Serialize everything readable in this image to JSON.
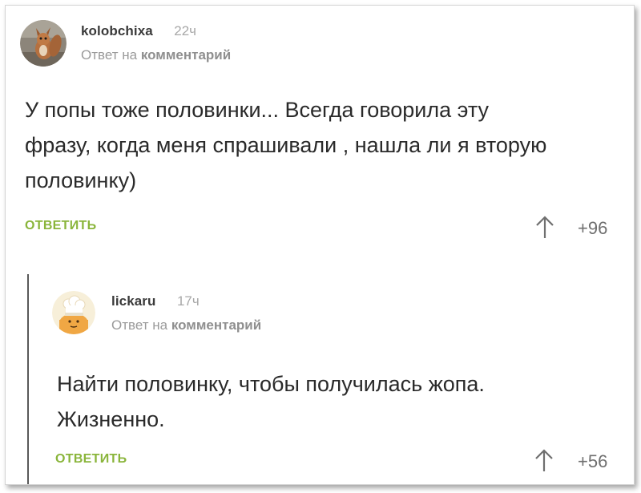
{
  "comments": [
    {
      "username": "kolobchixa",
      "time": "22ч",
      "reply_prefix": "Ответ на",
      "reply_link": "комментарий",
      "lines": [
        "У попы тоже половинки... Всегда говорила эту",
        "фразу, когда меня спрашивали , нашла ли я вторую",
        "половинку)"
      ],
      "reply_button": "ОТВЕТИТЬ",
      "score": "+96",
      "avatar_icon": "squirrel-avatar-icon"
    },
    {
      "username": "lickaru",
      "time": "17ч",
      "reply_prefix": "Ответ на",
      "reply_link": "комментарий",
      "lines": [
        "Найти половинку, чтобы получилась жопа.",
        "Жизненно."
      ],
      "reply_button": "ОТВЕТИТЬ",
      "score": "+56",
      "avatar_icon": "chef-avatar-icon"
    }
  ],
  "colors": {
    "accent_green": "#8ab53b",
    "thread_line": "#5a5a5a"
  }
}
